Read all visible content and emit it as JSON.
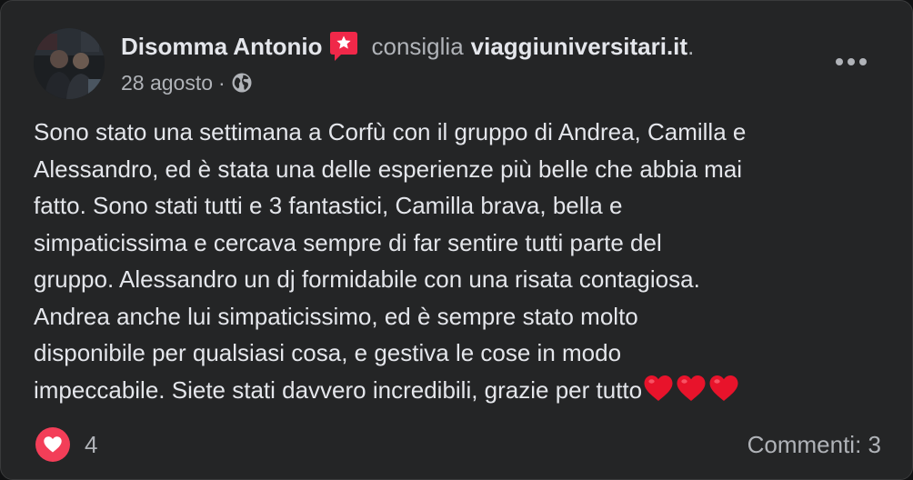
{
  "post": {
    "author_name": "Disomma Antonio",
    "recommend_icon": "recommendation-star-icon",
    "verb": "consiglia",
    "page_name": "viaggiuniversitari.it",
    "trailing_dot": ".",
    "date": "28 agosto",
    "meta_separator": "·",
    "privacy_icon": "globe-icon",
    "more_icon": "more-options-icon",
    "text_lines": [
      "Sono stato una settimana a Corfù con il gruppo di Andrea, Camilla e",
      "Alessandro, ed è stata una delle esperienze più belle che abbia mai",
      "fatto. Sono stati tutti e 3 fantastici, Camilla brava, bella e",
      "simpaticissima e cercava sempre di far sentire tutti parte del",
      "gruppo. Alessandro un dj formidabile con una risata contagiosa.",
      "Andrea anche lui simpaticissimo, ed è sempre stato molto",
      "disponibile per qualsiasi cosa, e gestiva le cose in modo",
      "impeccabile. Siete stati davvero incredibili, grazie per tutto"
    ],
    "emoji": [
      "red-heart",
      "red-heart",
      "red-heart"
    ]
  },
  "footer": {
    "reaction_icon": "love-reaction-icon",
    "reaction_count": "4",
    "comments_label": "Commenti: 3"
  },
  "colors": {
    "background": "#242526",
    "primary_text": "#e4e6eb",
    "secondary_text": "#b0b3b8",
    "recommend_red": "#f02849",
    "love_reaction": "#f33e58",
    "heart_emoji": "#e8132b"
  }
}
